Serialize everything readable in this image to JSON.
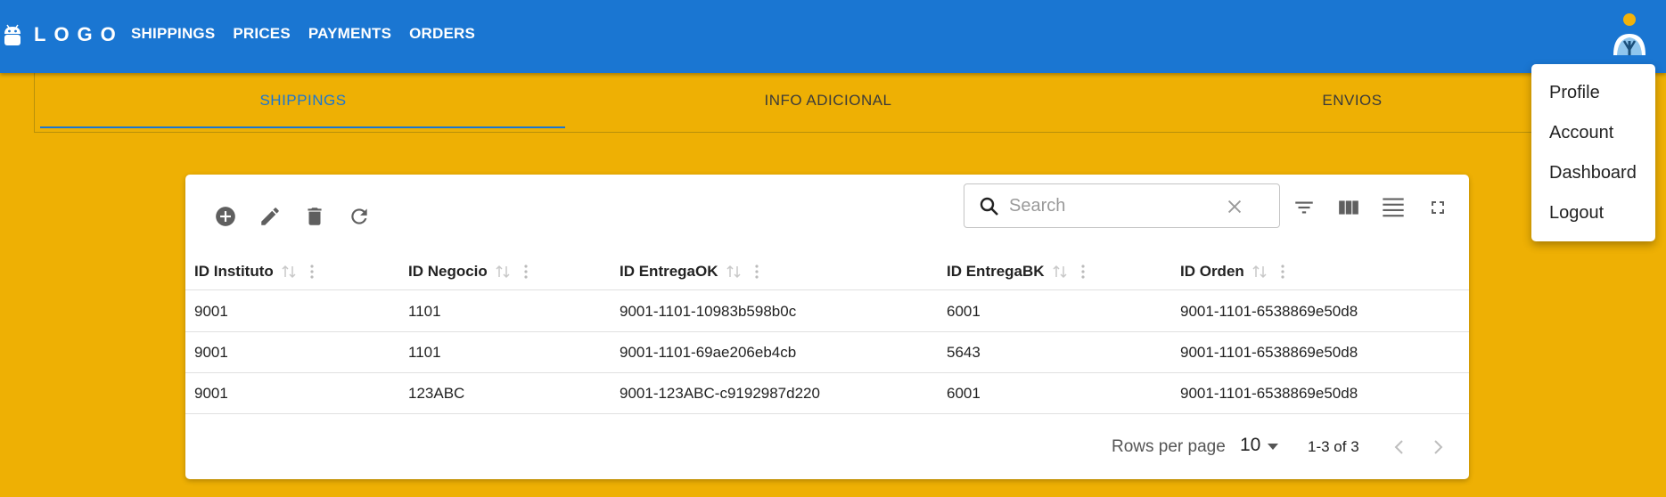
{
  "appbar": {
    "logo_text": "LOGO",
    "nav": [
      "SHIPPINGS",
      "PRICES",
      "PAYMENTS",
      "ORDERS"
    ],
    "color": "#1A76D2"
  },
  "tabs": [
    {
      "label": "SHIPPINGS",
      "active": true
    },
    {
      "label": "INFO ADICIONAL",
      "active": false
    },
    {
      "label": "ENVIOS",
      "active": false
    }
  ],
  "user_menu": {
    "items": [
      "Profile",
      "Account",
      "Dashboard",
      "Logout"
    ]
  },
  "toolbar": {
    "left_icons": [
      "add-circle-icon",
      "edit-icon",
      "delete-icon",
      "refresh-icon"
    ],
    "search_placeholder": "Search",
    "search_value": "",
    "right_icons": [
      "filter-icon",
      "columns-icon",
      "density-icon",
      "fullscreen-icon"
    ]
  },
  "table": {
    "columns": [
      "ID Instituto",
      "ID Negocio",
      "ID EntregaOK",
      "ID EntregaBK",
      "ID Orden"
    ],
    "rows": [
      [
        "9001",
        "1101",
        "9001-1101-10983b598b0c",
        "6001",
        "9001-1101-6538869e50d8"
      ],
      [
        "9001",
        "1101",
        "9001-1101-69ae206eb4cb",
        "5643",
        "9001-1101-6538869e50d8"
      ],
      [
        "9001",
        "123ABC",
        "9001-123ABC-c9192987d220",
        "6001",
        "9001-1101-6538869e50d8"
      ]
    ]
  },
  "pagination": {
    "rows_per_page_label": "Rows per page",
    "rows_per_page_value": "10",
    "range_text": "1-3 of 3"
  },
  "colors": {
    "background": "#EEB004",
    "primary": "#1A76D2"
  }
}
